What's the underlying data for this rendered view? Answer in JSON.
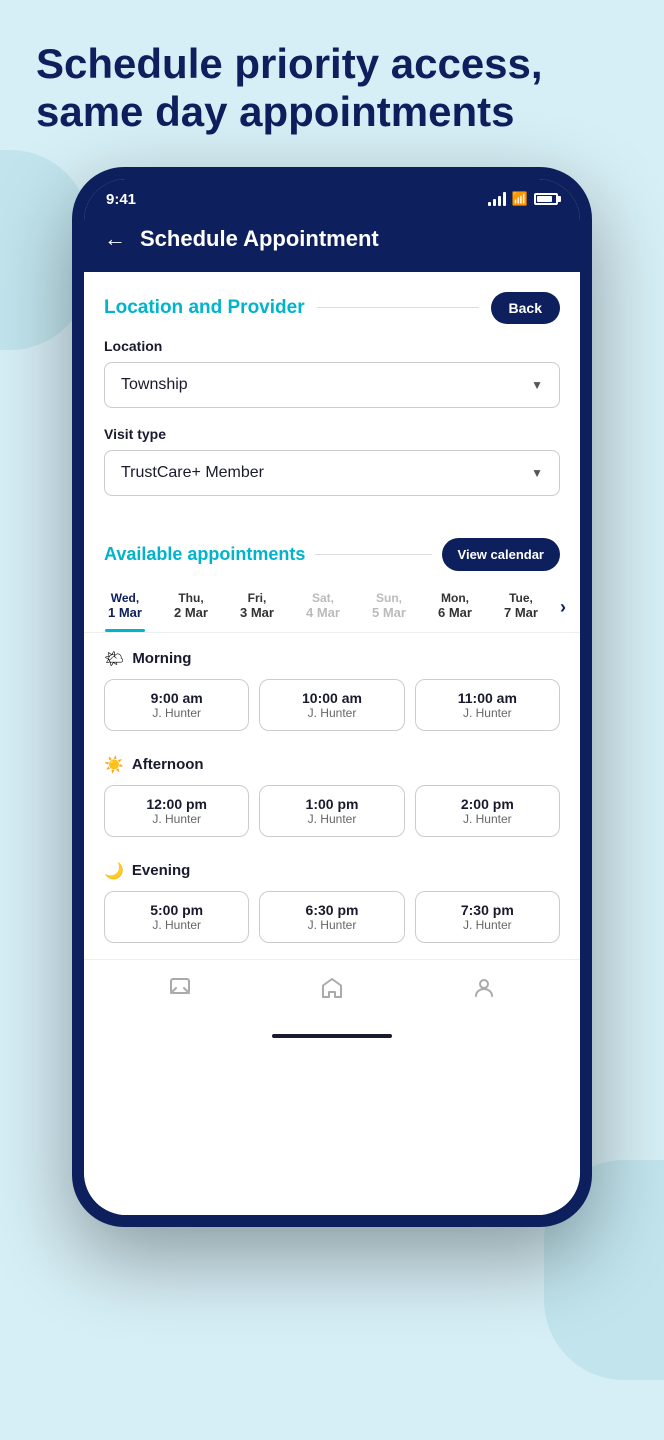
{
  "hero": {
    "title": "Schedule priority access, same day appointments"
  },
  "status_bar": {
    "time": "9:41"
  },
  "header": {
    "title": "Schedule Appointment",
    "back_label": "←"
  },
  "location_provider": {
    "section_title": "Location and Provider",
    "back_button": "Back",
    "location_label": "Location",
    "location_value": "Township",
    "visit_type_label": "Visit type",
    "visit_type_value": "TrustCare+ Member"
  },
  "available_appointments": {
    "section_title": "Available appointments",
    "view_calendar_label": "View calendar"
  },
  "days": [
    {
      "name": "Wed,",
      "date": "1 Mar",
      "active": true,
      "disabled": false
    },
    {
      "name": "Thu,",
      "date": "2 Mar",
      "active": false,
      "disabled": false
    },
    {
      "name": "Fri,",
      "date": "3 Mar",
      "active": false,
      "disabled": false
    },
    {
      "name": "Sat,",
      "date": "4 Mar",
      "active": false,
      "disabled": true
    },
    {
      "name": "Sun,",
      "date": "5 Mar",
      "active": false,
      "disabled": true
    },
    {
      "name": "Mon,",
      "date": "6 Mar",
      "active": false,
      "disabled": false
    },
    {
      "name": "Tue,",
      "date": "7 Mar",
      "active": false,
      "disabled": false
    }
  ],
  "time_groups": [
    {
      "id": "morning",
      "label": "Morning",
      "icon": "🌤",
      "slots": [
        {
          "time": "9:00 am",
          "provider": "J. Hunter"
        },
        {
          "time": "10:00 am",
          "provider": "J. Hunter"
        },
        {
          "time": "11:00 am",
          "provider": "J. Hunter"
        }
      ]
    },
    {
      "id": "afternoon",
      "label": "Afternoon",
      "icon": "☀️",
      "slots": [
        {
          "time": "12:00 pm",
          "provider": "J. Hunter"
        },
        {
          "time": "1:00 pm",
          "provider": "J. Hunter"
        },
        {
          "time": "2:00 pm",
          "provider": "J. Hunter"
        }
      ]
    },
    {
      "id": "evening",
      "label": "Evening",
      "icon": "🌙",
      "slots": [
        {
          "time": "5:00 pm",
          "provider": "J. Hunter"
        },
        {
          "time": "6:30 pm",
          "provider": "J. Hunter"
        },
        {
          "time": "7:30 pm",
          "provider": "J. Hunter"
        }
      ]
    }
  ],
  "bottom_nav": [
    {
      "icon": "💬",
      "label": "messages"
    },
    {
      "icon": "🏠",
      "label": "home"
    },
    {
      "icon": "👤",
      "label": "profile"
    }
  ]
}
